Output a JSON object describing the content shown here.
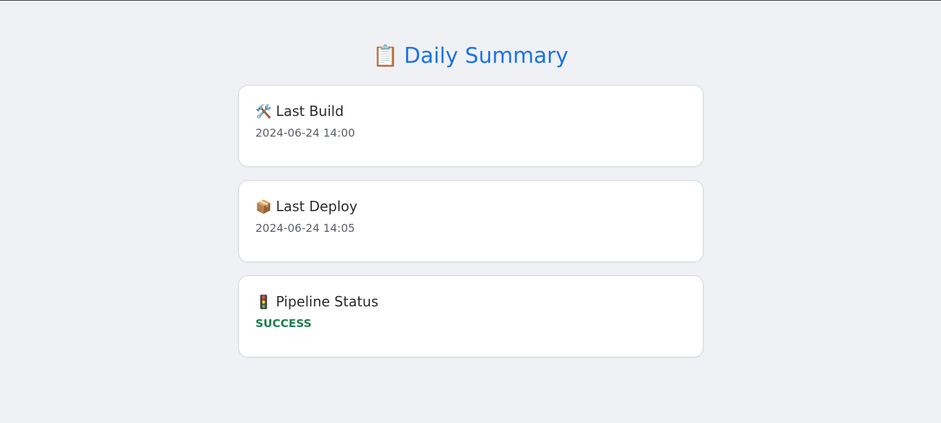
{
  "page": {
    "title": "Daily Summary",
    "title_icon": "📋",
    "title_icon_name": "clipboard-icon"
  },
  "cards": [
    {
      "icon": "🛠️",
      "icon_name": "hammer-and-wrench-icon",
      "heading": "Last Build",
      "value": "2024-06-24 14:00"
    },
    {
      "icon": "📦",
      "icon_name": "package-icon",
      "heading": "Last Deploy",
      "value": "2024-06-24 14:05"
    },
    {
      "icon": "🚦",
      "icon_name": "traffic-light-icon",
      "heading": "Pipeline Status",
      "value": "SUCCESS"
    }
  ],
  "colors": {
    "background": "#f0f1f5",
    "title": "#1a73e8",
    "success": "#1e7f4f"
  }
}
